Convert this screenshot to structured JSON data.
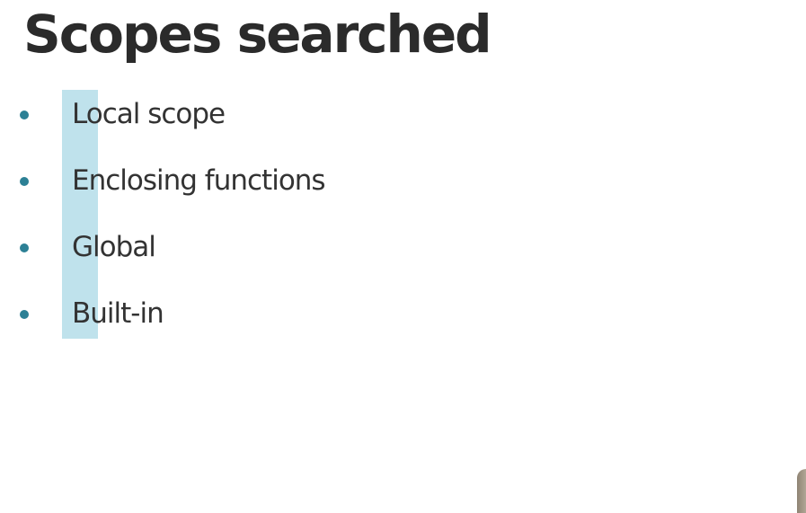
{
  "slide": {
    "title": "Scopes searched",
    "bullets": [
      {
        "label": "Local scope"
      },
      {
        "label": "Enclosing functions"
      },
      {
        "label": "Global"
      },
      {
        "label": "Built-in"
      }
    ]
  },
  "colors": {
    "title_text": "#2b2b2b",
    "body_text": "#333333",
    "bullet_dot": "#2c8095",
    "highlight_bar": "#bfe2ec",
    "background": "#ffffff"
  }
}
